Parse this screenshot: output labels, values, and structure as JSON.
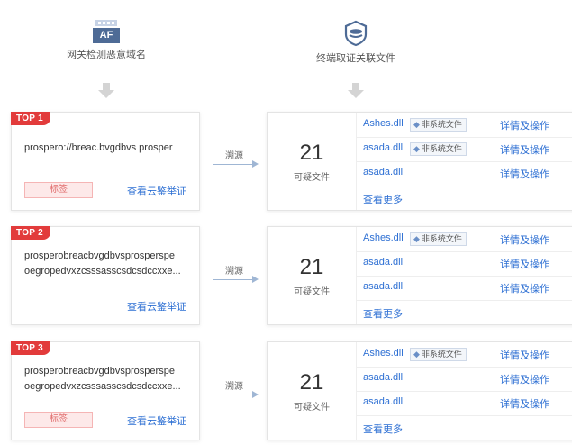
{
  "headers": {
    "left": {
      "icon_text": "AF",
      "label": "网关检测恶意域名"
    },
    "right": {
      "label": "终端取证关联文件"
    }
  },
  "trace_label": "溯源",
  "cards": [
    {
      "rank": "TOP 1",
      "domain_lines": [
        "prospero://breac.bvgdbvs  prosper"
      ],
      "tag": "标签",
      "evidence_link": "查看云鉴举证",
      "count": "21",
      "count_label": "可疑文件",
      "files": [
        {
          "name": "Ashes.dll",
          "badge": "非系统文件",
          "action": "详情及操作"
        },
        {
          "name": "asada.dll",
          "badge": "非系统文件",
          "action": "详情及操作"
        },
        {
          "name": "asada.dll",
          "badge": "",
          "action": "详情及操作"
        }
      ],
      "more": "查看更多"
    },
    {
      "rank": "TOP 2",
      "domain_lines": [
        "prosperobreacbvgdbvsprosperspe",
        "oegropedvxzcsssasscsdcsdccxxe..."
      ],
      "tag": "",
      "evidence_link": "查看云鉴举证",
      "count": "21",
      "count_label": "可疑文件",
      "files": [
        {
          "name": "Ashes.dll",
          "badge": "非系统文件",
          "action": "详情及操作"
        },
        {
          "name": "asada.dll",
          "badge": "",
          "action": "详情及操作"
        },
        {
          "name": "asada.dll",
          "badge": "",
          "action": "详情及操作"
        }
      ],
      "more": "查看更多"
    },
    {
      "rank": "TOP 3",
      "domain_lines": [
        "prosperobreacbvgdbvsprosperspe",
        "oegropedvxzcsssasscsdcsdccxxe..."
      ],
      "tag": "标签",
      "evidence_link": "查看云鉴举证",
      "count": "21",
      "count_label": "可疑文件",
      "files": [
        {
          "name": "Ashes.dll",
          "badge": "非系统文件",
          "action": "详情及操作"
        },
        {
          "name": "asada.dll",
          "badge": "",
          "action": "详情及操作"
        },
        {
          "name": "asada.dll",
          "badge": "",
          "action": "详情及操作"
        }
      ],
      "more": "查看更多"
    }
  ],
  "colors": {
    "accent": "#2d6fd3",
    "top_badge": "#e23b3b",
    "tag_bg": "#fde9e9"
  }
}
